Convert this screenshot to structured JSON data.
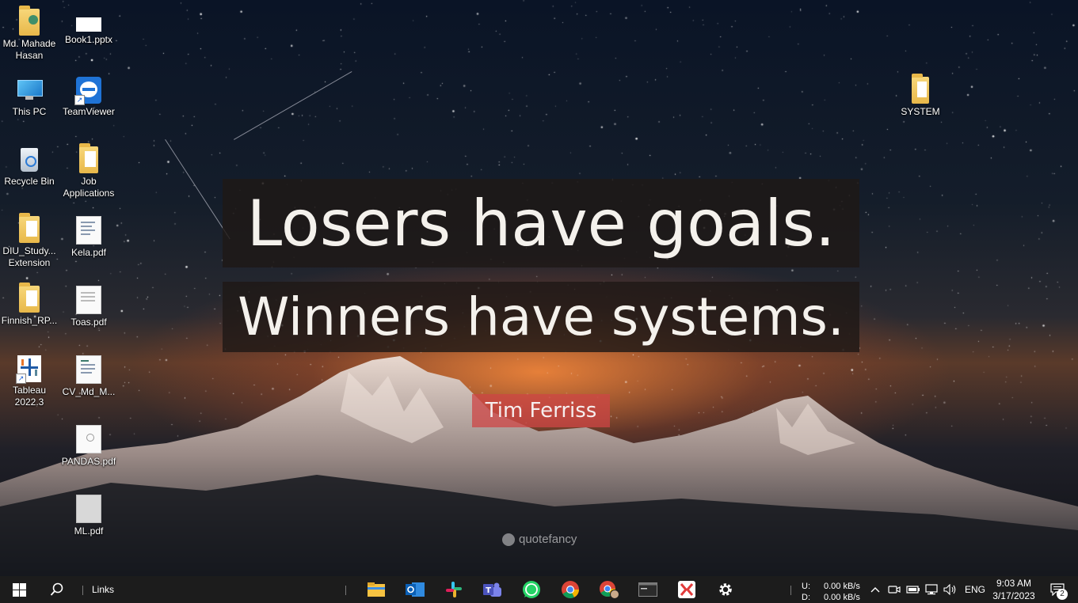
{
  "wallpaper": {
    "quote_line1": "Losers have goals.",
    "quote_line2": "Winners have systems.",
    "author": "Tim Ferriss",
    "watermark": "quotefancy"
  },
  "desktop_icons": {
    "user_folder": "Md. Mahade Hasan",
    "book1": "Book1.pptx",
    "this_pc": "This PC",
    "teamviewer": "TeamViewer",
    "system": "SYSTEM",
    "recycle_bin": "Recycle Bin",
    "job_applications": "Job Applications",
    "diu_study": "DIU_Study... Extension",
    "kela": "Kela.pdf",
    "finnish": "Finnish_RP...",
    "toas": "Toas.pdf",
    "tableau": "Tableau 2022.3",
    "cv": "CV_Md_M...",
    "pandas": "PANDAS.pdf",
    "ml": "ML.pdf"
  },
  "taskbar": {
    "links_label": "Links",
    "net_up_label": "U:",
    "net_down_label": "D:",
    "net_up_value": "0.00 kB/s",
    "net_down_value": "0.00 kB/s",
    "language": "ENG",
    "time": "9:03 AM",
    "date": "3/17/2023",
    "notification_count": "2",
    "pinned_apps": [
      "file-explorer",
      "outlook",
      "slack",
      "teams",
      "whatsapp",
      "chrome",
      "chrome-profile",
      "terminal",
      "kingsoft",
      "settings"
    ]
  },
  "colors": {
    "taskbar_bg": "#1c1c1c",
    "quote_box_bg": "#1e1916",
    "author_box_bg": "#cd4646",
    "folder_yellow": "#f0c75e"
  }
}
